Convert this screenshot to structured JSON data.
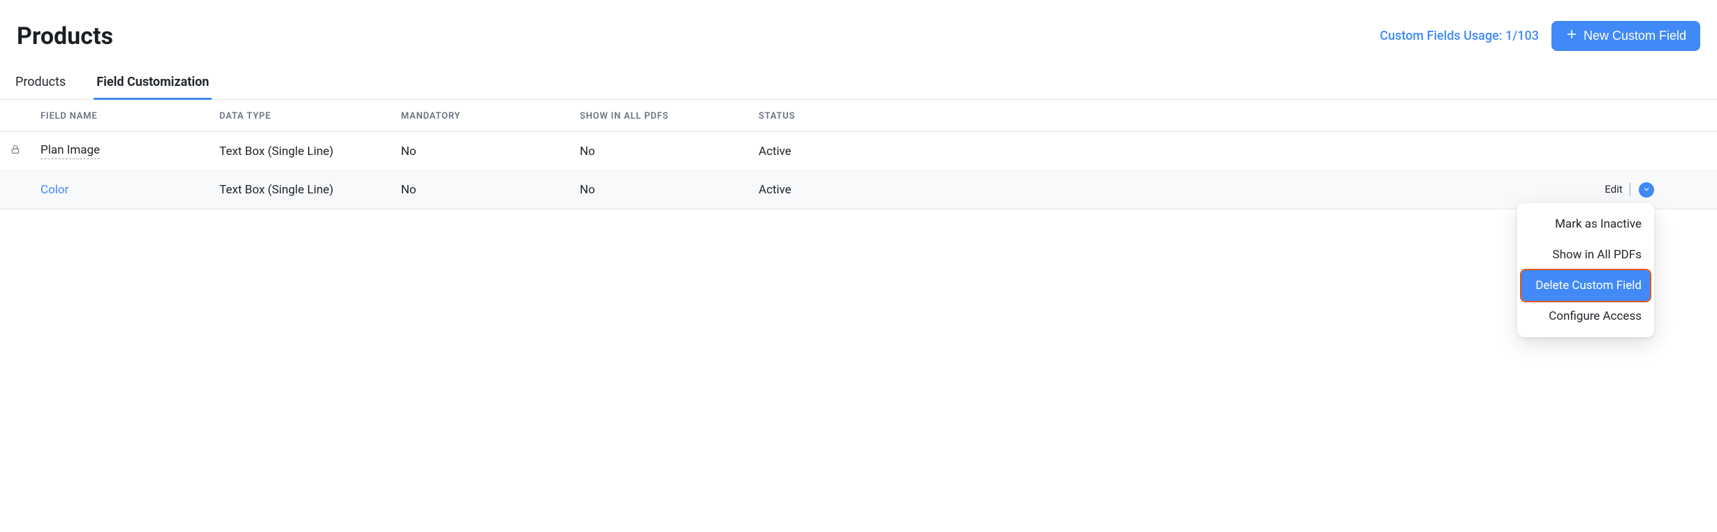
{
  "header": {
    "title": "Products",
    "usage_label": "Custom Fields Usage: 1/103",
    "new_button_label": "New Custom Field"
  },
  "tabs": [
    {
      "label": "Products",
      "active": false
    },
    {
      "label": "Field Customization",
      "active": true
    }
  ],
  "table": {
    "columns": {
      "field_name": "FIELD NAME",
      "data_type": "DATA TYPE",
      "mandatory": "MANDATORY",
      "show_pdfs": "SHOW IN ALL PDFS",
      "status": "STATUS"
    },
    "rows": [
      {
        "locked": true,
        "name": "Plan Image",
        "type": "Text Box (Single Line)",
        "mandatory": "No",
        "show_pdfs": "No",
        "status": "Active",
        "hover": false
      },
      {
        "locked": false,
        "name": "Color",
        "type": "Text Box (Single Line)",
        "mandatory": "No",
        "show_pdfs": "No",
        "status": "Active",
        "hover": true
      }
    ],
    "row_actions": {
      "edit": "Edit"
    }
  },
  "dropdown": {
    "items": [
      {
        "label": "Mark as Inactive",
        "highlight": false
      },
      {
        "label": "Show in All PDFs",
        "highlight": false
      },
      {
        "label": "Delete Custom Field",
        "highlight": true
      },
      {
        "label": "Configure Access",
        "highlight": false
      }
    ]
  }
}
